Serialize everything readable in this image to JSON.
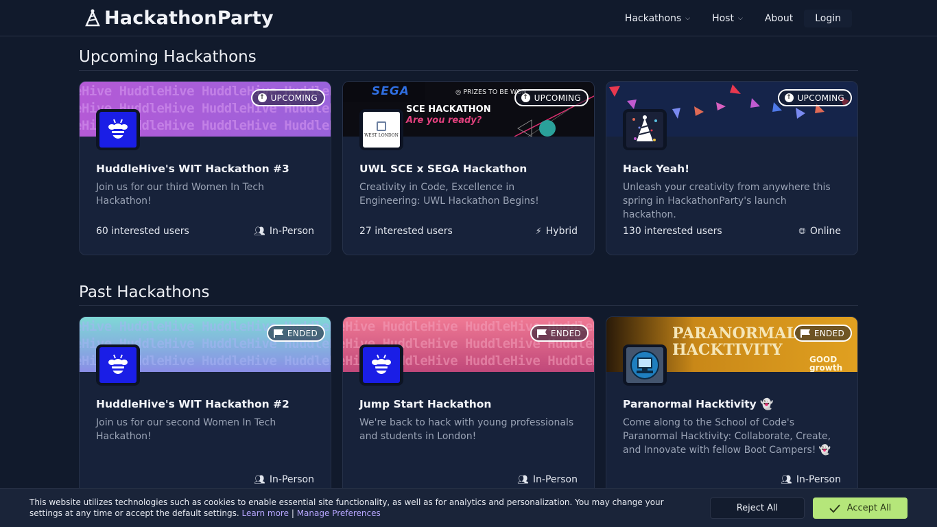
{
  "brand": {
    "name": "HackathonParty"
  },
  "nav": {
    "hackathons": "Hackathons",
    "host": "Host",
    "about": "About",
    "login": "Login"
  },
  "sections": {
    "upcoming": "Upcoming Hackathons",
    "past": "Past Hackathons"
  },
  "upcoming": [
    {
      "badge": "UPCOMING",
      "title": "HuddleHive's WIT Hackathon #3",
      "description": "Join us for our third Women In Tech Hackathon!",
      "interested": "60 interested users",
      "mode": "In-Person",
      "banner_text": "eHive HuddleHive HuddleHive HuddleHive"
    },
    {
      "badge": "UPCOMING",
      "title": "UWL SCE x SEGA Hackathon",
      "description": "Creativity in Code, Excellence in Engineering: UWL Hackathon Begins!",
      "interested": "27 interested users",
      "mode": "Hybrid",
      "banner_logo": "SEGA",
      "banner_prizes": "PRIZES TO BE WON",
      "banner_headline": "SCE HACKATHON",
      "banner_sub": "Are you ready?",
      "avatar_text": "WEST LONDON"
    },
    {
      "badge": "UPCOMING",
      "title": "Hack Yeah!",
      "description": "Unleash your creativity from anywhere this spring in HackathonParty's launch hackathon.",
      "interested": "130 interested users",
      "mode": "Online"
    }
  ],
  "past": [
    {
      "badge": "ENDED",
      "title": "HuddleHive's WIT Hackathon #2",
      "description": "Join us for our second Women In Tech Hackathon!",
      "mode": "In-Person",
      "banner_text": "eHive HuddleHive HuddleHive HuddleHive"
    },
    {
      "badge": "ENDED",
      "title": "Jump Start Hackathon",
      "description": "We're back to hack with young professionals and students in London!",
      "mode": "In-Person",
      "banner_text": "eHive HuddleHive HuddleHive HuddleHive"
    },
    {
      "badge": "ENDED",
      "title": "Paranormal Hacktivity 👻",
      "description": "Come along to the School of Code's Paranormal Hacktivity: Collaborate, Create, and Innovate with fellow Boot Campers! 👻",
      "mode": "In-Person",
      "banner_headline": "PARANORMAL HACKTIVITY",
      "banner_sponsor": "GOOD growth"
    }
  ],
  "cookie": {
    "text": "This website utilizes technologies such as cookies to enable essential site functionality, as well as for analytics and personalization. You may change your settings at any time or accept the default settings.",
    "learn_more": "Learn more",
    "separator": "|",
    "manage": "Manage Preferences",
    "reject": "Reject All",
    "accept": "Accept All"
  },
  "colors": {
    "background": "#111a2c",
    "card": "#17223a",
    "accept": "#b5e67a",
    "link": "#b6a6ff"
  }
}
